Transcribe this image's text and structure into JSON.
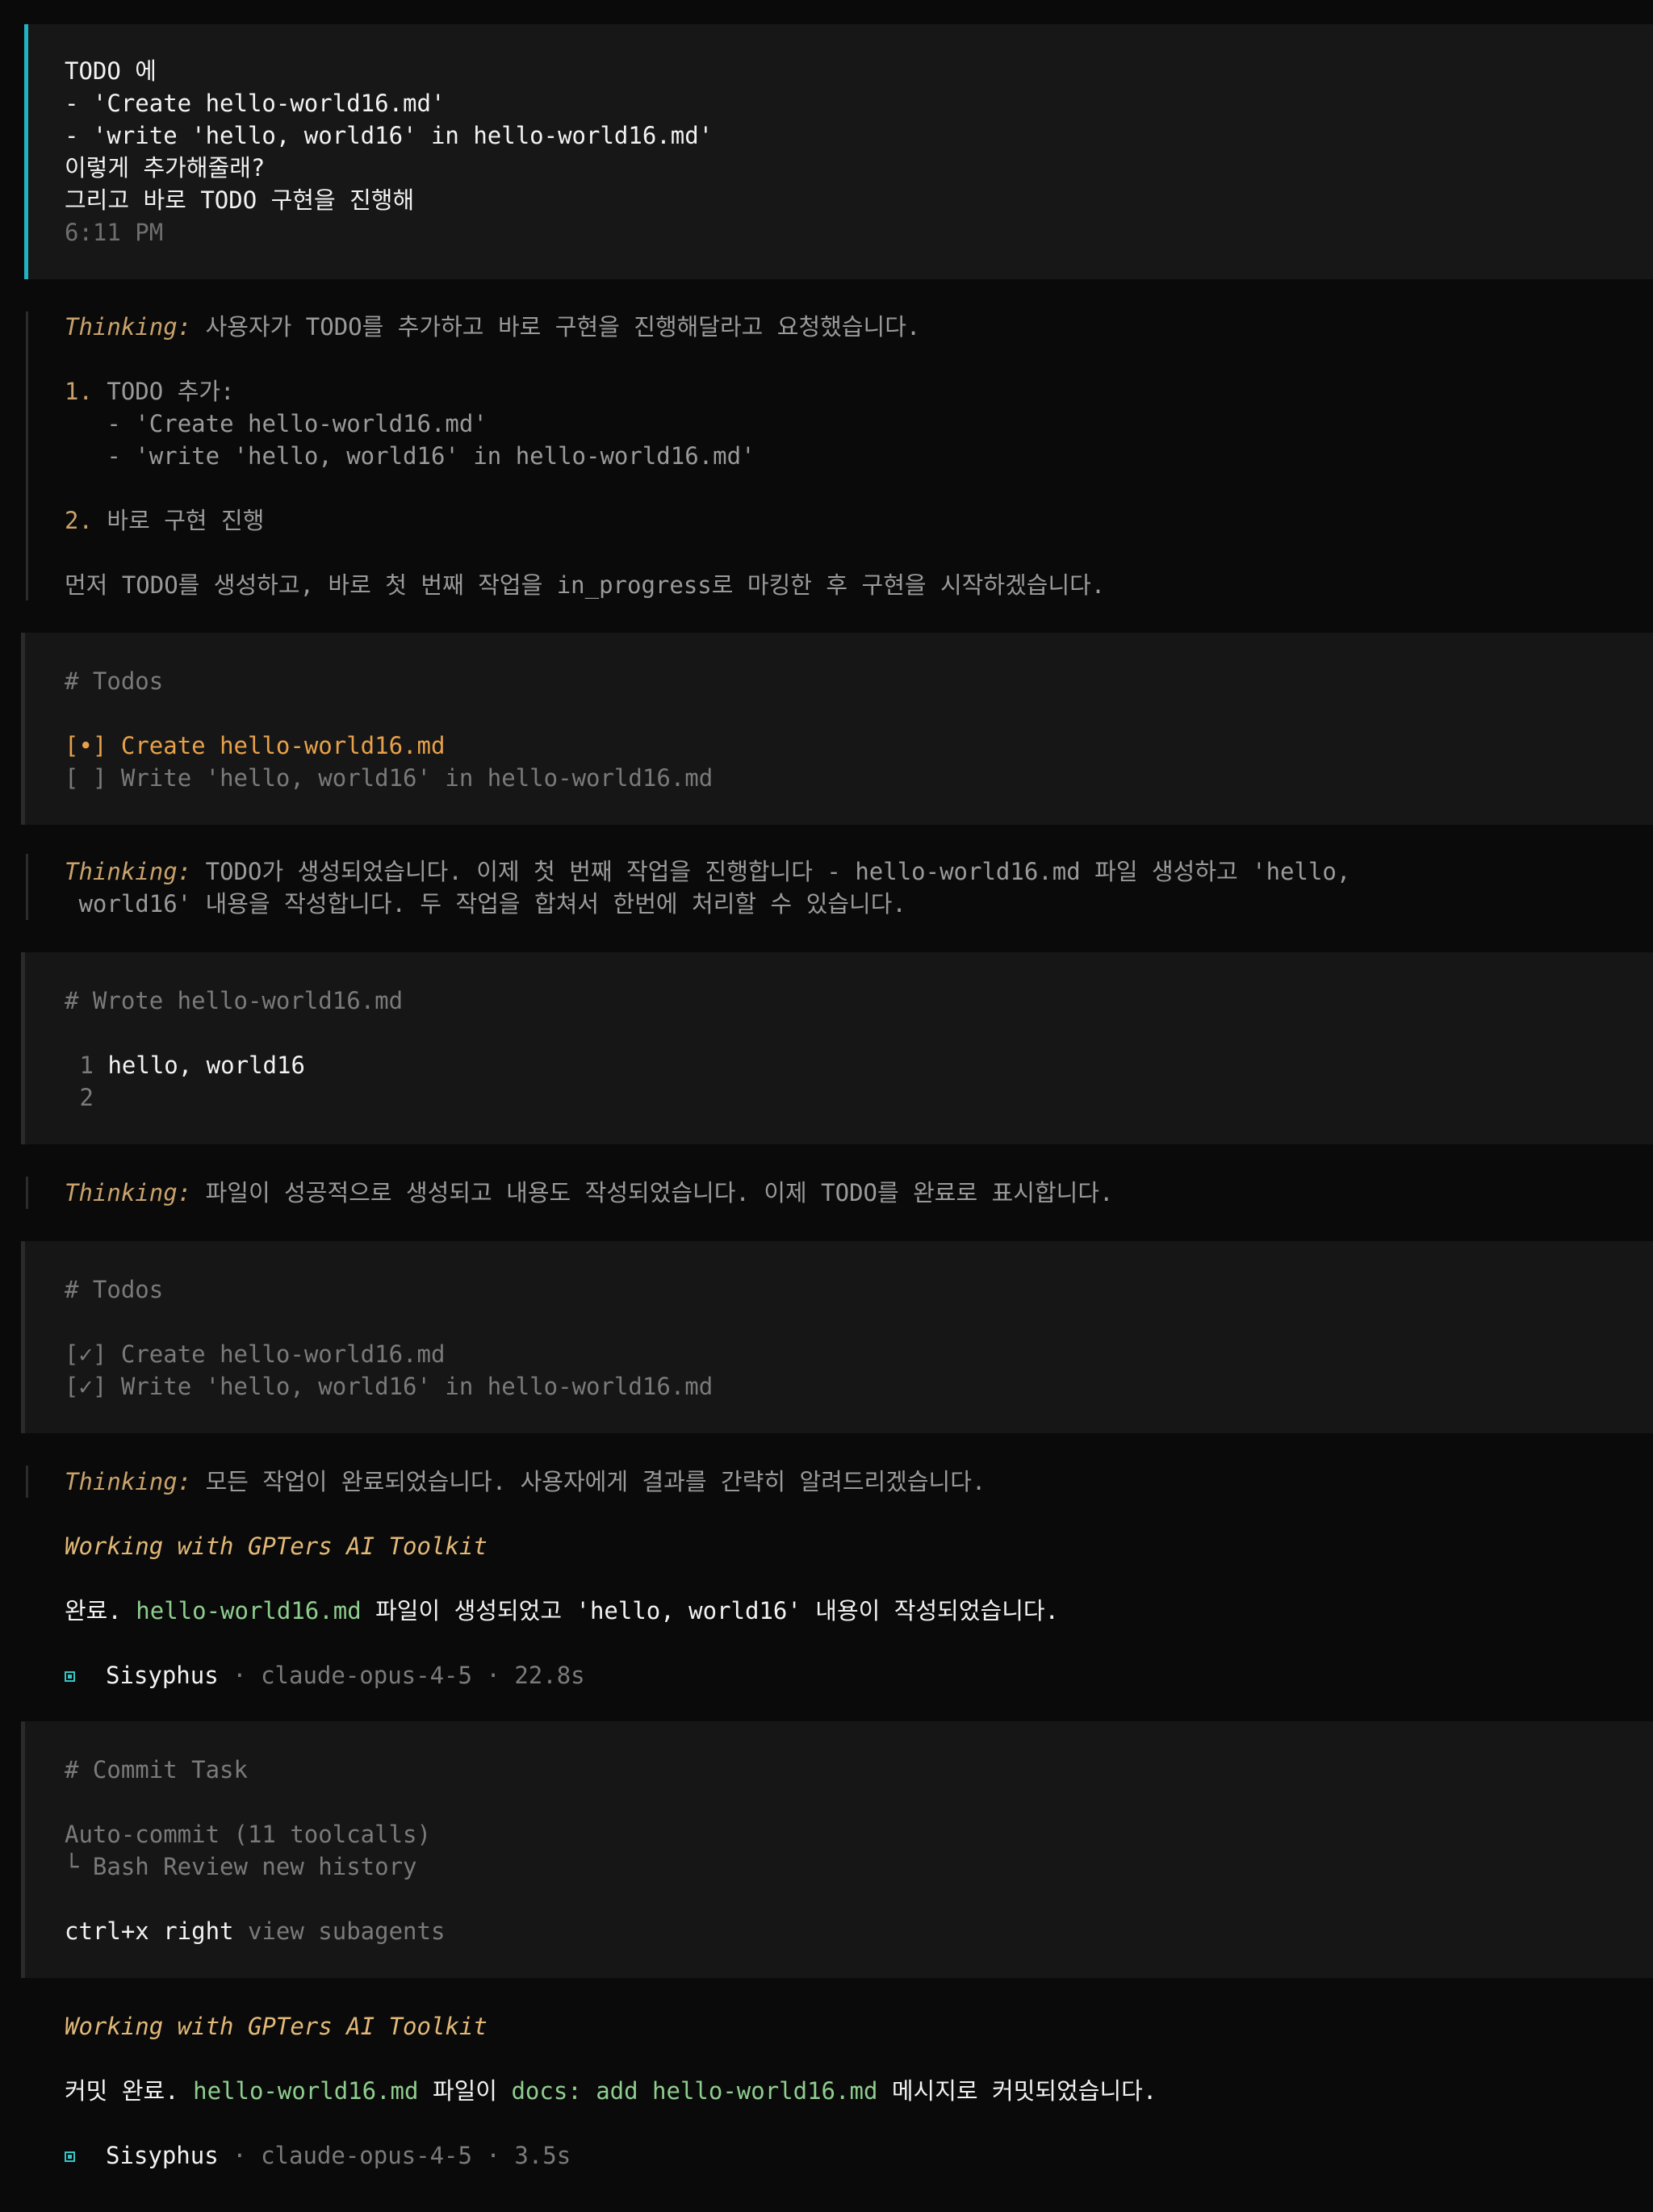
{
  "user_message": {
    "lines": [
      "TODO 에",
      "- 'Create hello-world16.md'",
      "- 'write 'hello, world16' in hello-world16.md'",
      "이렇게 추가해줄래?",
      "그리고 바로 TODO 구현을 진행해"
    ],
    "time": "6:11 PM"
  },
  "thinking_label": "Thinking:",
  "thinking1": {
    "text": "사용자가 TODO를 추가하고 바로 구현을 진행해달라고 요청했습니다.",
    "step1_num": "1.",
    "step1_text": "TODO 추가:",
    "step1_sub1": "- 'Create hello-world16.md'",
    "step1_sub2": "- 'write 'hello, world16' in hello-world16.md'",
    "step2_num": "2.",
    "step2_text": "바로 구현 진행",
    "final": "먼저 TODO를 생성하고, 바로 첫 번째 작업을 in_progress로 마킹한 후 구현을 시작하겠습니다."
  },
  "todos1": {
    "header": "# Todos",
    "item1_box": "[•]",
    "item1_text": "Create hello-world16.md",
    "item2_box": "[ ]",
    "item2_text": "Write 'hello, world16' in hello-world16.md"
  },
  "thinking2": {
    "line1": "TODO가 생성되었습니다. 이제 첫 번째 작업을 진행합니다 - hello-world16.md 파일 생성하고 'hello,",
    "line2": " world16' 내용을 작성합니다. 두 작업을 합쳐서 한번에 처리할 수 있습니다."
  },
  "wrote": {
    "header": "# Wrote hello-world16.md",
    "line1_num": "1",
    "line1_text": "hello, world16",
    "line2_num": "2"
  },
  "thinking3": {
    "text": "파일이 성공적으로 생성되고 내용도 작성되었습니다. 이제 TODO를 완료로 표시합니다."
  },
  "todos2": {
    "header": "# Todos",
    "item1_box": "[✓]",
    "item1_text": "Create hello-world16.md",
    "item2_box": "[✓]",
    "item2_text": "Write 'hello, world16' in hello-world16.md"
  },
  "thinking4": {
    "text": "모든 작업이 완료되었습니다. 사용자에게 결과를 간략히 알려드리겠습니다."
  },
  "response1": {
    "working": "Working with GPTers AI Toolkit",
    "prefix": "완료.",
    "file": "hello-world16.md",
    "suffix": "파일이 생성되었고 'hello, world16' 내용이 작성되었습니다.",
    "agent": "Sisyphus",
    "meta": "· claude-opus-4-5 · 22.8s"
  },
  "commit": {
    "header": "# Commit Task",
    "line1": "Auto-commit (11 toolcalls)",
    "line2": "└ Bash Review new history",
    "shortcut": "ctrl+x right",
    "shortcut_hint": "view subagents"
  },
  "response2": {
    "working": "Working with GPTers AI Toolkit",
    "prefix": "커밋 완료.",
    "file": "hello-world16.md",
    "middle": "파일이",
    "message": "docs: add hello-world16.md",
    "suffix": "메시지로 커밋되었습니다.",
    "agent": "Sisyphus",
    "meta": "· claude-opus-4-5 · 3.5s"
  },
  "colors": {
    "background": "#0a0a0a",
    "accent_cyan": "#21b3c3",
    "amber": "#c9a26b",
    "green": "#8fce8f",
    "orange": "#e8a14a"
  }
}
